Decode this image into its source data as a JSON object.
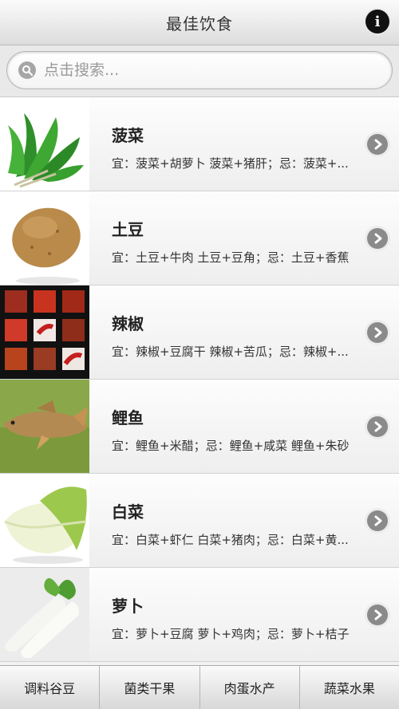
{
  "header": {
    "title": "最佳饮食"
  },
  "search": {
    "placeholder": "点击搜索..."
  },
  "items": [
    {
      "name": "菠菜",
      "desc": "宜：菠菜+胡萝卜 菠菜+猪肝；忌：菠菜+..."
    },
    {
      "name": "土豆",
      "desc": "宜：土豆+牛肉 土豆+豆角；忌：土豆+香蕉"
    },
    {
      "name": "辣椒",
      "desc": "宜：辣椒+豆腐干 辣椒+苦瓜；忌：辣椒+..."
    },
    {
      "name": "鲤鱼",
      "desc": "宜：鲤鱼+米醋；忌：鲤鱼+咸菜 鲤鱼+朱砂"
    },
    {
      "name": "白菜",
      "desc": "宜：白菜+虾仁 白菜+猪肉；忌：白菜+黄..."
    },
    {
      "name": "萝卜",
      "desc": "宜：萝卜+豆腐 萝卜+鸡肉；忌：萝卜+桔子"
    }
  ],
  "tabs": [
    "调料谷豆",
    "菌类干果",
    "肉蛋水产",
    "蔬菜水果"
  ],
  "colors": {
    "header_bg": "#e4e4e4",
    "chevron": "#8a8a8a",
    "info_button": "#111111"
  }
}
